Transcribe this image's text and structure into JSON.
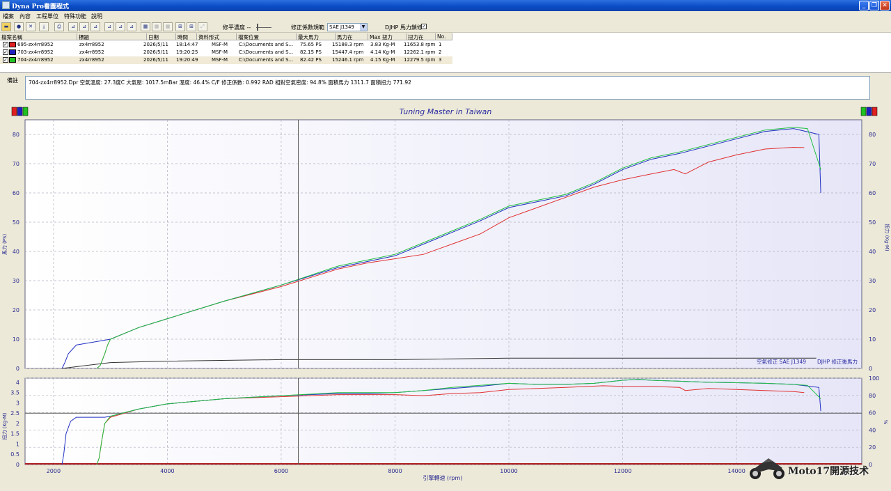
{
  "window": {
    "title": "Dyna Pro看圖程式",
    "btn_min": "_",
    "btn_max": "❐",
    "btn_close": "✕"
  },
  "menu": [
    "檔案",
    "內容",
    "工程單位",
    "特殊功能",
    "說明"
  ],
  "toolbar": {
    "smooth_label": "修平濃度 --",
    "standard_label": "修正係數規範",
    "standard_value": "SAE J1349",
    "djhp_label": "DJHP 馬力鎖修",
    "djhp_checked": "✓",
    "icons": [
      "open-icon",
      "color-icon",
      "delete-icon",
      "export-icon",
      "print-icon",
      "hp-curve-icon",
      "torque-curve-icon",
      "afr-curve-icon",
      "overlay-icon",
      "compare-icon",
      "grid-icon",
      "table-icon",
      "zoom-icon",
      "scale-icon",
      "fit-icon",
      "fullscreen-icon"
    ]
  },
  "filelist": {
    "headers": [
      "檔案名稱",
      "標題",
      "日期",
      "時間",
      "資料形式",
      "檔案位置",
      "最大馬力",
      "馬力在",
      "Max 扭力",
      "扭力在",
      "No."
    ],
    "rows": [
      {
        "check": "✓",
        "color": "#e02020",
        "name": "695-zx4rr8952",
        "title": "zx4rr8952",
        "date": "2026/5/11",
        "time": "18:14:47",
        "type": "MSF-M",
        "path": "C:\\Documents and S...",
        "max_hp": "75.65 PS",
        "hp_at": "15188.3 rpm",
        "max_tq": "3.83 Kg-M",
        "tq_at": "11653.8 rpm",
        "no": "1"
      },
      {
        "check": "✓",
        "color": "#2020c0",
        "name": "703-zx4rr8952",
        "title": "zx4rr8952",
        "date": "2026/5/11",
        "time": "19:20:25",
        "type": "MSF-M",
        "path": "C:\\Documents and S...",
        "max_hp": "82.15 PS",
        "hp_at": "15447.4 rpm",
        "max_tq": "4.14 Kg-M",
        "tq_at": "12262.1 rpm",
        "no": "2"
      },
      {
        "check": "✓",
        "color": "#20c020",
        "name": "704-zx4rr8952",
        "title": "zx4rr8952",
        "date": "2026/5/11",
        "time": "19:20:49",
        "type": "MSF-M",
        "path": "C:\\Documents and S...",
        "max_hp": "82.42 PS",
        "hp_at": "15246.1 rpm",
        "max_tq": "4.15 Kg-M",
        "tq_at": "12279.5 rpm",
        "no": "3"
      }
    ]
  },
  "notes": {
    "label": "備註",
    "text": "704-zx4rr8952.Dpr  空氣溫度: 27.3度C  大氣壓: 1017.5mBar  溼度: 46.4%  C/F 修正係數: 0.992  RAD 相對空氣密度: 94.8%  面積馬力 1311.7  面積扭力 771.92"
  },
  "chart_data": [
    {
      "type": "line",
      "title": "Tuning Master in Taiwan",
      "ylabel": "馬力 (PS)",
      "y2label": "扭力 (Kg-M)",
      "xlim": [
        1500,
        16200
      ],
      "ylim": [
        0,
        85
      ],
      "y2lim": [
        0,
        85
      ],
      "yticks": [
        0,
        10,
        20,
        30,
        40,
        50,
        60,
        70,
        80
      ],
      "annotations": [
        "空氣修正 SAE J1349",
        "DJHP 修正後馬力"
      ],
      "cursor_rpm": 6300,
      "series": [
        {
          "name": "695-zx4rr8952",
          "color": "#e03030",
          "x": [
            2760,
            2820,
            2900,
            2950,
            3000,
            3500,
            4000,
            5000,
            6000,
            7000,
            7500,
            8000,
            8500,
            9000,
            9500,
            10000,
            10500,
            11000,
            11500,
            12000,
            12500,
            12900,
            13100,
            13300,
            13500,
            14000,
            14500,
            15000,
            15188
          ],
          "y": [
            0,
            1,
            5,
            8,
            10,
            14,
            17,
            23,
            28,
            34,
            36,
            37.5,
            39,
            42.5,
            46,
            51.5,
            55,
            58.5,
            62,
            64.5,
            66.5,
            68,
            66.5,
            68.5,
            70.5,
            73,
            75,
            75.6,
            75.5
          ]
        },
        {
          "name": "703-zx4rr8952",
          "color": "#2030c0",
          "x": [
            2150,
            2200,
            2260,
            2400,
            2700,
            3000,
            3500,
            4000,
            5000,
            6000,
            7000,
            7500,
            8000,
            8500,
            9000,
            9500,
            10000,
            10500,
            11000,
            11500,
            12000,
            12500,
            13000,
            13500,
            14000,
            14500,
            15000,
            15447,
            15480
          ],
          "y": [
            0,
            2,
            5,
            8,
            9,
            10,
            14,
            17,
            23,
            28.5,
            34.5,
            36.5,
            38.5,
            42.5,
            46.5,
            50.5,
            55,
            57,
            59,
            63,
            68,
            71.5,
            73.5,
            76,
            78.5,
            81,
            82,
            80,
            60
          ]
        },
        {
          "name": "704-zx4rr8952",
          "color": "#20c040",
          "x": [
            2760,
            2820,
            2900,
            2950,
            3000,
            3500,
            4000,
            5000,
            6000,
            7000,
            7500,
            8000,
            8500,
            9000,
            9500,
            10000,
            10500,
            11000,
            11500,
            12000,
            12500,
            13000,
            13500,
            14000,
            14500,
            15000,
            15246,
            15480
          ],
          "y": [
            0,
            1,
            5,
            8,
            10,
            14,
            17,
            23,
            28.5,
            35,
            37,
            39,
            43,
            47,
            51,
            55.5,
            57.5,
            59.5,
            63.5,
            68.5,
            72,
            74,
            76.5,
            79,
            81.5,
            82.4,
            82,
            68
          ]
        }
      ],
      "loss_series": {
        "x": [
          2150,
          3000,
          4000,
          6000,
          8000,
          10000,
          12000,
          14000,
          15400
        ],
        "y": [
          0,
          2,
          2.5,
          3,
          3,
          3.5,
          3.5,
          3.5,
          3.5
        ]
      }
    },
    {
      "type": "line",
      "xlabel": "引擎轉速 (rpm)",
      "ylabel": "扭力 (Kg-M)",
      "y2label": "%",
      "xlim": [
        1500,
        16200
      ],
      "ylim": [
        0,
        4.2
      ],
      "yticks": [
        0,
        0.5,
        1,
        1.5,
        2,
        2.5,
        3,
        3.5,
        4
      ],
      "y2ticks": [
        0,
        20,
        40,
        60,
        80,
        100
      ],
      "xticks": [
        2000,
        4000,
        6000,
        8000,
        10000,
        12000,
        14000
      ],
      "cursor_rpm": 6300,
      "reference_line": 2.5,
      "series": [
        {
          "name": "695-zx4rr8952",
          "color": "#e03030",
          "x": [
            2760,
            2800,
            2850,
            2900,
            3000,
            3500,
            4000,
            5000,
            6000,
            7000,
            7500,
            8000,
            8500,
            9000,
            9500,
            10000,
            11000,
            11653,
            12000,
            12500,
            13000,
            13100,
            13500,
            14000,
            14500,
            15000,
            15188
          ],
          "y": [
            0,
            0.3,
            1.2,
            2,
            2.3,
            2.7,
            2.95,
            3.2,
            3.3,
            3.4,
            3.4,
            3.4,
            3.35,
            3.45,
            3.5,
            3.65,
            3.75,
            3.83,
            3.8,
            3.8,
            3.75,
            3.6,
            3.7,
            3.65,
            3.6,
            3.55,
            3.5
          ]
        },
        {
          "name": "703-zx4rr8952",
          "color": "#2030c0",
          "x": [
            2150,
            2180,
            2220,
            2300,
            2400,
            2700,
            2900,
            3000,
            3500,
            4000,
            5000,
            6000,
            7000,
            7500,
            8000,
            8500,
            9000,
            9500,
            10000,
            10500,
            11000,
            11500,
            12000,
            12262,
            12500,
            13000,
            13500,
            14000,
            14500,
            15000,
            15447,
            15480
          ],
          "y": [
            0,
            0.5,
            1.5,
            2.1,
            2.3,
            2.3,
            2.3,
            2.35,
            2.7,
            2.95,
            3.2,
            3.35,
            3.45,
            3.45,
            3.5,
            3.6,
            3.7,
            3.8,
            3.95,
            3.9,
            3.9,
            3.95,
            4.1,
            4.14,
            4.1,
            4.05,
            4.0,
            3.98,
            3.95,
            3.9,
            3.75,
            2.6
          ]
        },
        {
          "name": "704-zx4rr8952",
          "color": "#20c040",
          "x": [
            2760,
            2800,
            2850,
            2900,
            3000,
            3500,
            4000,
            5000,
            6000,
            7000,
            7500,
            8000,
            8500,
            9000,
            9500,
            10000,
            10500,
            11000,
            11500,
            12000,
            12280,
            12500,
            13000,
            13500,
            14000,
            14500,
            15000,
            15246,
            15480
          ],
          "y": [
            0,
            0.3,
            1.2,
            2,
            2.35,
            2.7,
            2.95,
            3.2,
            3.35,
            3.5,
            3.5,
            3.5,
            3.6,
            3.75,
            3.85,
            3.95,
            3.9,
            3.9,
            3.95,
            4.1,
            4.15,
            4.1,
            4.05,
            4.0,
            3.98,
            3.95,
            3.9,
            3.85,
            3.2
          ]
        }
      ]
    }
  ],
  "watermark": {
    "text": "Moto17開源技术"
  },
  "colors": {
    "title_blue": "#2a2aa0",
    "plot_bg": "#f4f4fb",
    "frame": "#606080"
  }
}
